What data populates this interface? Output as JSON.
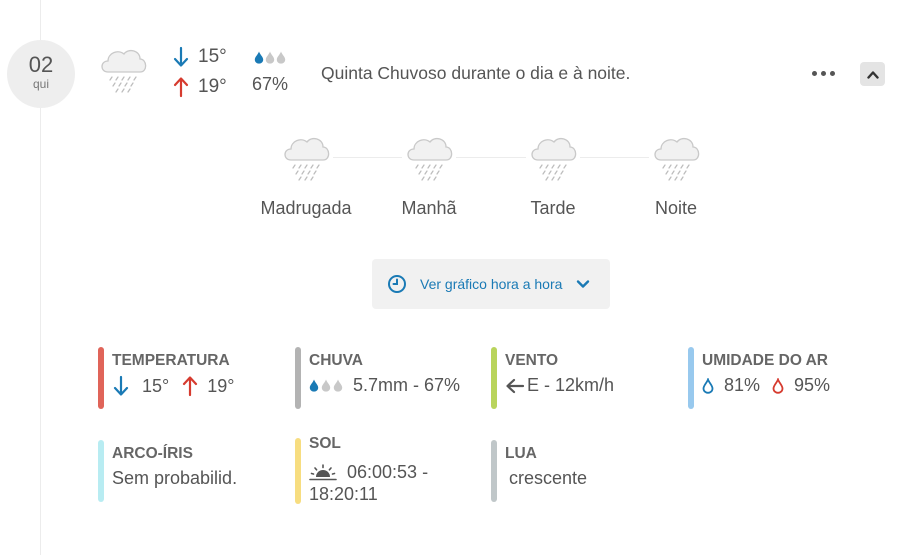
{
  "day": {
    "number": "02",
    "weekday": "qui"
  },
  "forecast": {
    "icon": "rain-cloud-icon",
    "min_temp": "15°",
    "max_temp": "19°",
    "rain_probability": "67%",
    "summary": "Quinta Chuvoso durante o dia e à noite."
  },
  "periods": [
    {
      "label": "Madrugada",
      "icon": "rain-cloud-icon"
    },
    {
      "label": "Manhã",
      "icon": "rain-cloud-icon"
    },
    {
      "label": "Tarde",
      "icon": "rain-cloud-icon"
    },
    {
      "label": "Noite",
      "icon": "rain-cloud-icon"
    }
  ],
  "hourly_button": {
    "label": "Ver gráfico hora a hora"
  },
  "details": {
    "temperature": {
      "title": "TEMPERATURA",
      "min": "15°",
      "max": "19°",
      "color": "#e06459"
    },
    "rain": {
      "title": "CHUVA",
      "value": "5.7mm - 67%",
      "color": "#b3b3b3"
    },
    "wind": {
      "title": "VENTO",
      "value": "E - 12km/h",
      "color": "#b9d45c"
    },
    "humidity": {
      "title": "UMIDADE DO AR",
      "min": "81%",
      "max": "95%",
      "color": "#98c9ee"
    },
    "rainbow": {
      "title": "ARCO-ÍRIS",
      "value": "Sem probabilid.",
      "color": "#b8ecf2"
    },
    "sun": {
      "title": "SOL",
      "sunrise": "06:00:53 -",
      "sunset": "18:20:11",
      "color": "#f7dd80"
    },
    "moon": {
      "title": "LUA",
      "value": "crescente",
      "color": "#c0c7c9"
    }
  },
  "colors": {
    "down_arrow": "#1a7ab5",
    "up_arrow": "#d63b2f",
    "link": "#1a7ab5",
    "drop_filled": "#1a7ab5",
    "drop_empty": "#c8c8c8"
  }
}
